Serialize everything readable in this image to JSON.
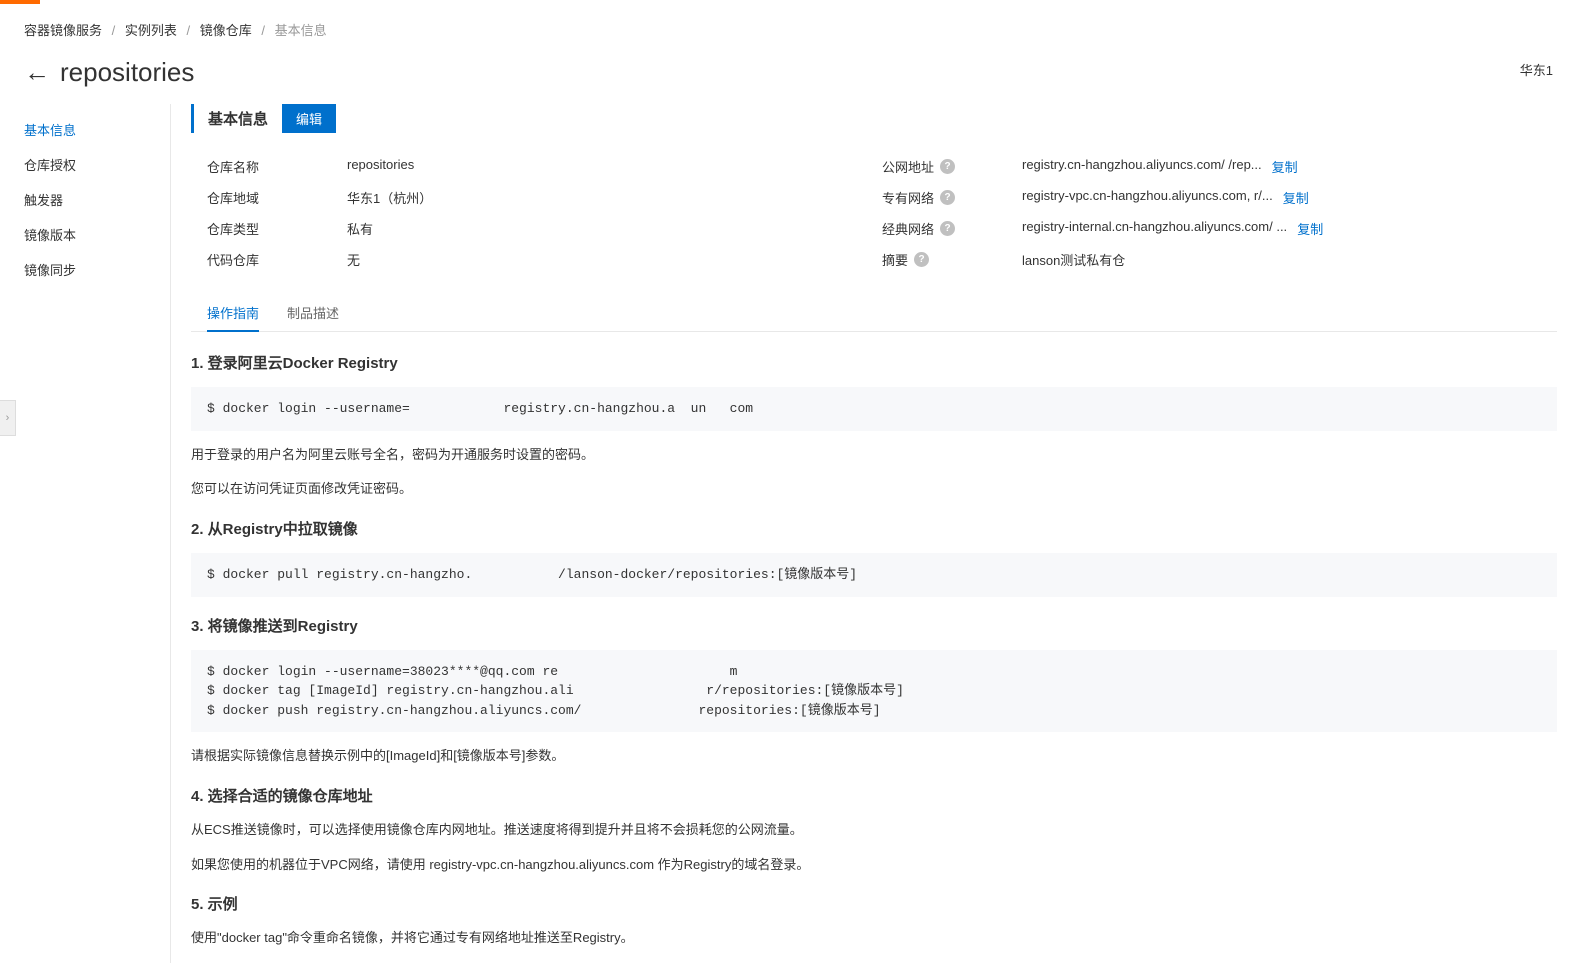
{
  "breadcrumb": {
    "item1": "容器镜像服务",
    "item2": "实例列表",
    "item3": "镜像仓库",
    "current": "基本信息"
  },
  "page_title": "repositories",
  "region_tag": "华东1",
  "sidebar": {
    "items": [
      {
        "label": "基本信息"
      },
      {
        "label": "仓库授权"
      },
      {
        "label": "触发器"
      },
      {
        "label": "镜像版本"
      },
      {
        "label": "镜像同步"
      }
    ]
  },
  "section": {
    "title": "基本信息",
    "edit_label": "编辑"
  },
  "info_left": [
    {
      "label": "仓库名称",
      "value": "repositories"
    },
    {
      "label": "仓库地域",
      "value": "华东1（杭州）"
    },
    {
      "label": "仓库类型",
      "value": "私有"
    },
    {
      "label": "代码仓库",
      "value": "无"
    }
  ],
  "info_right": [
    {
      "label": "公网地址",
      "help": true,
      "value": "registry.cn-hangzhou.aliyuncs.com/            /rep...",
      "copy": "复制"
    },
    {
      "label": "专有网络",
      "help": true,
      "value": "registry-vpc.cn-hangzhou.aliyuncs.com,           r/...",
      "copy": "复制"
    },
    {
      "label": "经典网络",
      "help": true,
      "value": "registry-internal.cn-hangzhou.aliyuncs.com/          ...",
      "copy": "复制"
    },
    {
      "label": "摘要",
      "help": true,
      "value": "lanson测试私有仓"
    }
  ],
  "tabs": [
    {
      "label": "操作指南"
    },
    {
      "label": "制品描述"
    }
  ],
  "guide": {
    "h1": "1. 登录阿里云Docker Registry",
    "code1": "$ docker login --username=            registry.cn-hangzhou.a  un   com",
    "p1a": "用于登录的用户名为阿里云账号全名，密码为开通服务时设置的密码。",
    "p1b": "您可以在访问凭证页面修改凭证密码。",
    "h2": "2. 从Registry中拉取镜像",
    "code2": "$ docker pull registry.cn-hangzho.           /lanson-docker/repositories:[镜像版本号]",
    "h3": "3. 将镜像推送到Registry",
    "code3": "$ docker login --username=38023****@qq.com re                      m\n$ docker tag [ImageId] registry.cn-hangzhou.ali                 r/repositories:[镜像版本号]\n$ docker push registry.cn-hangzhou.aliyuncs.com/               repositories:[镜像版本号]",
    "p3": "请根据实际镜像信息替换示例中的[ImageId]和[镜像版本号]参数。",
    "h4": "4. 选择合适的镜像仓库地址",
    "p4a": "从ECS推送镜像时，可以选择使用镜像仓库内网地址。推送速度将得到提升并且将不会损耗您的公网流量。",
    "p4b": "如果您使用的机器位于VPC网络，请使用 registry-vpc.cn-hangzhou.aliyuncs.com 作为Registry的域名登录。",
    "h5": "5. 示例",
    "p5": "使用\"docker tag\"命令重命名镜像，并将它通过专有网络地址推送至Registry。"
  },
  "expand_icon": "›"
}
